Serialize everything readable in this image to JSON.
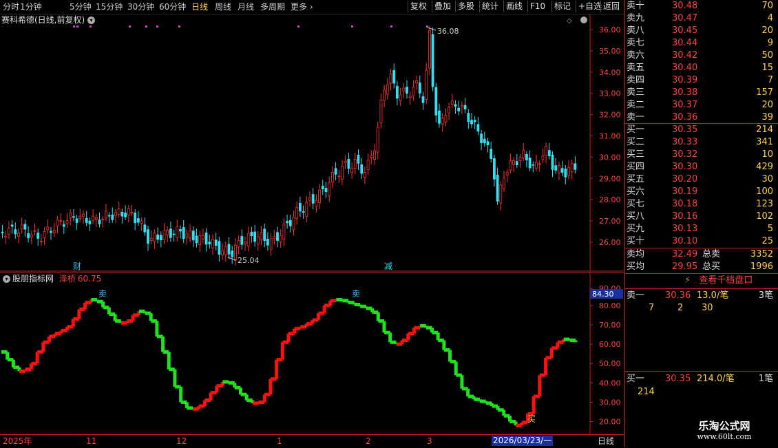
{
  "toolbar": {
    "periods": [
      "分时",
      "1分钟",
      "5分钟",
      "15分钟",
      "30分钟",
      "60分钟",
      "日线",
      "周线",
      "月线",
      "多周期",
      "更多"
    ],
    "active_period": "日线",
    "buttons": [
      "复权",
      "叠加",
      "多股",
      "统计",
      "画线",
      "F10",
      "标记",
      "+自选",
      "返回"
    ]
  },
  "main_chart": {
    "title": "赛科希德(日线,前复权)",
    "price_axis": [
      "36.00",
      "35.00",
      "34.00",
      "33.00",
      "32.00",
      "31.00",
      "30.00",
      "29.00",
      "28.00",
      "27.00",
      "26.00"
    ],
    "high_marker": "36.08",
    "low_marker": "25.04",
    "event_labels": [
      "财",
      "减"
    ]
  },
  "indicator": {
    "title": "股朋指标网",
    "series_name": "泽桥",
    "current_value": "60.75",
    "axis": [
      "90.00",
      "80.00",
      "70.00",
      "60.00",
      "50.00",
      "40.00",
      "30.00",
      "20.00"
    ],
    "cursor_value": "84.30",
    "signals": [
      "卖",
      "卖",
      "买"
    ],
    "chart_data": {
      "type": "line",
      "title": "",
      "ylim": [
        15,
        92
      ],
      "x_count": 120,
      "series": [
        {
          "name": "泽桥",
          "values": [
            56,
            52,
            48,
            46,
            47,
            50,
            56,
            61,
            64,
            65.5,
            67,
            69,
            73,
            78,
            81.5,
            83,
            82,
            79,
            75.5,
            72,
            71,
            72,
            75,
            77,
            76,
            72,
            64,
            56,
            47,
            38,
            30,
            27,
            26.5,
            28,
            31,
            35,
            38.5,
            40.5,
            40,
            37.5,
            34,
            31,
            29.5,
            30,
            34,
            42,
            52,
            61,
            65.5,
            68,
            69,
            70.5,
            72.5,
            76,
            80,
            82.5,
            83,
            82.5,
            81.5,
            80.5,
            79.5,
            78.5,
            76.5,
            72,
            66,
            61,
            60,
            62,
            65.5,
            68.5,
            69.5,
            68.5,
            66,
            62,
            57,
            51,
            44,
            37,
            33,
            31.5,
            30.5,
            29.5,
            28,
            26,
            23,
            20,
            18,
            19.5,
            24,
            33,
            44,
            53,
            58,
            61,
            62.5,
            62,
            61
          ]
        }
      ]
    }
  },
  "date_axis": [
    "2025年",
    "11",
    "12",
    "1",
    "2",
    "3"
  ],
  "cursor_date": "2026/03/23/—",
  "period_label": "日线",
  "orderbook": {
    "asks": [
      {
        "label": "卖十",
        "price": "30.48",
        "vol": "70"
      },
      {
        "label": "卖九",
        "price": "30.47",
        "vol": "4"
      },
      {
        "label": "卖八",
        "price": "30.45",
        "vol": "20"
      },
      {
        "label": "卖七",
        "price": "30.44",
        "vol": "9"
      },
      {
        "label": "卖六",
        "price": "30.42",
        "vol": "50"
      },
      {
        "label": "卖五",
        "price": "30.40",
        "vol": "15"
      },
      {
        "label": "卖四",
        "price": "30.39",
        "vol": "7"
      },
      {
        "label": "卖三",
        "price": "30.38",
        "vol": "157"
      },
      {
        "label": "卖二",
        "price": "30.37",
        "vol": "20"
      },
      {
        "label": "卖一",
        "price": "30.36",
        "vol": "39"
      }
    ],
    "bids": [
      {
        "label": "买一",
        "price": "30.35",
        "vol": "214"
      },
      {
        "label": "买二",
        "price": "30.33",
        "vol": "341"
      },
      {
        "label": "买三",
        "price": "30.32",
        "vol": "10"
      },
      {
        "label": "买四",
        "price": "30.30",
        "vol": "429"
      },
      {
        "label": "买五",
        "price": "30.20",
        "vol": "30"
      },
      {
        "label": "买六",
        "price": "30.19",
        "vol": "100"
      },
      {
        "label": "买七",
        "price": "30.18",
        "vol": "123"
      },
      {
        "label": "买八",
        "price": "30.16",
        "vol": "102"
      },
      {
        "label": "买九",
        "price": "30.13",
        "vol": "5"
      },
      {
        "label": "买十",
        "price": "30.10",
        "vol": "25"
      }
    ],
    "avg_sell": {
      "label": "卖均",
      "price": "32.49",
      "total_label": "总卖",
      "total": "3352"
    },
    "avg_buy": {
      "label": "买均",
      "price": "29.95",
      "total_label": "总买",
      "total": "1996"
    },
    "view_depth_button": "查看千档盘口",
    "queue_sell": {
      "label": "卖一",
      "price": "30.36",
      "per_order": "13.0/笔",
      "count": "3笔",
      "orders": [
        "7",
        "2",
        "30"
      ]
    },
    "queue_buy": {
      "label": "买一",
      "price": "30.35",
      "per_order": "214.0/笔",
      "count": "1笔",
      "orders": [
        "214"
      ]
    }
  },
  "watermark": {
    "title": "乐淘公式网",
    "url": "www.60lt.com"
  },
  "colors": {
    "up": "#ff3030",
    "down": "#30e0f0",
    "ind_up": "#ff1010",
    "ind_down": "#20e020",
    "border": "#c02020"
  }
}
